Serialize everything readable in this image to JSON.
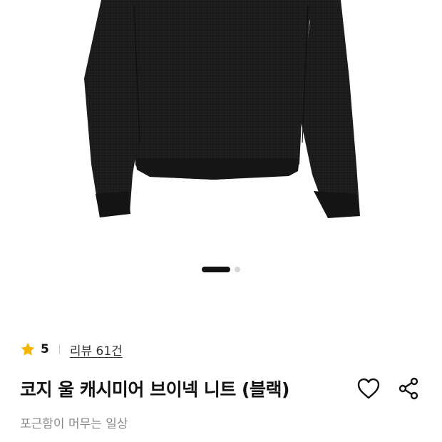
{
  "product": {
    "image_alt": "black v-neck knit sweater",
    "rating": "5",
    "review_link": "리뷰 61건",
    "title": "코지 울 캐시미어 브이넥 니트 (블랙)",
    "subtitle": "포근함이 머무는 일상"
  },
  "carousel": {
    "total_slides": 2,
    "active_index": 0
  },
  "icons": {
    "rating_star": "star-icon",
    "wishlist": "heart-outline-icon",
    "share": "share-icon"
  },
  "colors": {
    "star": "#F5B400",
    "text_primary": "#111111",
    "text_secondary": "#8A8A8A",
    "sweater": "#1B1B1B",
    "pager_active": "#111111",
    "pager_inactive": "#D6D6D6"
  }
}
